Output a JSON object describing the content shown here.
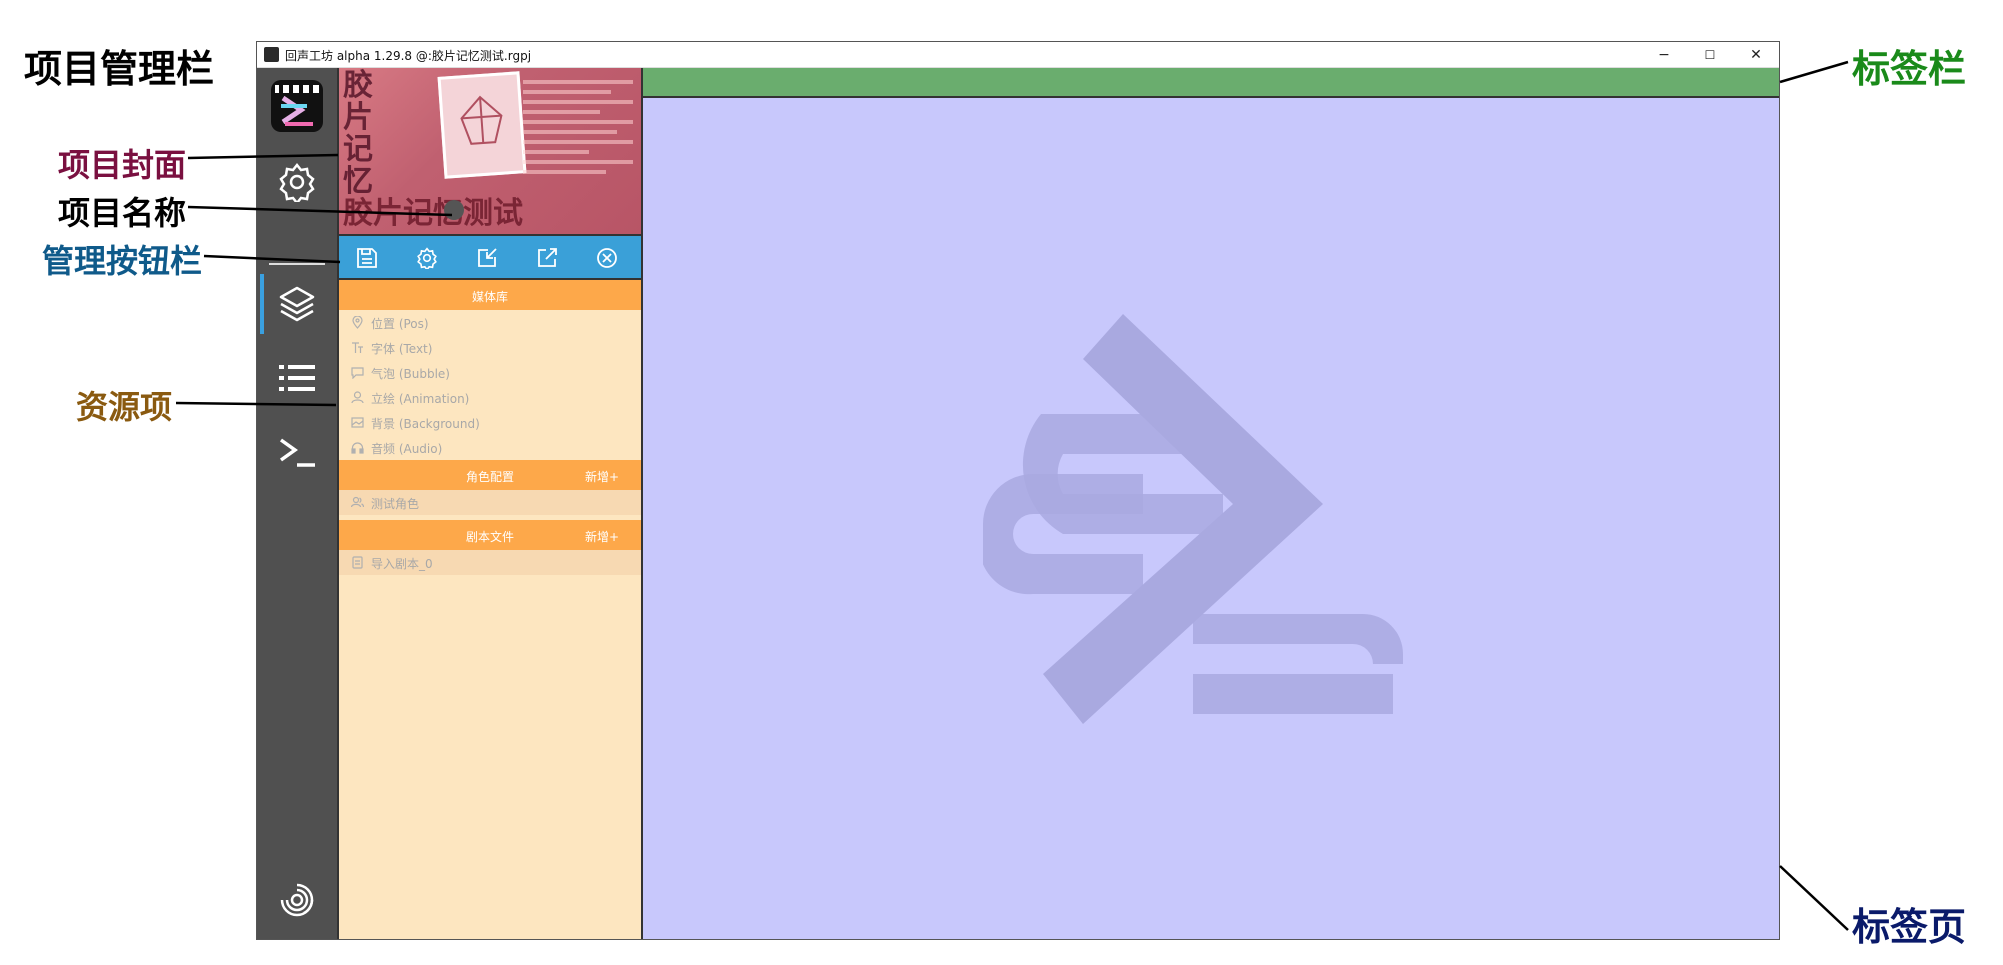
{
  "annotations": {
    "project_bar": "项目管理栏",
    "project_cover": "项目封面",
    "project_name": "项目名称",
    "manage_buttons": "管理按钮栏",
    "resource_item": "资源项",
    "tab_bar": "标签栏",
    "tab_page": "标签页",
    "colors": {
      "project_bar": "#000000",
      "project_cover": "#7a1040",
      "project_name": "#000000",
      "manage_buttons": "#0f5a8a",
      "resource_item": "#8a5a10",
      "tab_bar": "#1a8a1a",
      "tab_page": "#0a1a6a"
    }
  },
  "window": {
    "title": "回声工坊 alpha 1.29.8 @:胶片记忆测试.rgpj",
    "minimize": "−",
    "maximize": "☐",
    "close": "✕"
  },
  "sidebar": {
    "icons": [
      "app-logo-icon",
      "settings-gear-icon",
      "layers-icon",
      "list-icon",
      "terminal-icon",
      "spiral-icon"
    ]
  },
  "project": {
    "cover_text": "胶片记忆",
    "name": "胶片记忆测试"
  },
  "manage_buttons": [
    "save-icon",
    "project-settings-icon",
    "import-icon",
    "export-icon",
    "close-project-icon"
  ],
  "media_library": {
    "header": "媒体库",
    "items": [
      {
        "label": "位置 (Pos)",
        "icon": "pin-icon"
      },
      {
        "label": "字体 (Text)",
        "icon": "text-icon"
      },
      {
        "label": "气泡 (Bubble)",
        "icon": "bubble-icon"
      },
      {
        "label": "立绘 (Animation)",
        "icon": "person-icon"
      },
      {
        "label": "背景 (Background)",
        "icon": "image-icon"
      },
      {
        "label": "音频 (Audio)",
        "icon": "headphone-icon"
      }
    ]
  },
  "character_config": {
    "header": "角色配置",
    "add": "新增+",
    "items": [
      {
        "label": "测试角色",
        "icon": "users-icon"
      }
    ]
  },
  "script_files": {
    "header": "剧本文件",
    "add": "新增+",
    "items": [
      {
        "label": "导入剧本_0",
        "icon": "file-icon"
      }
    ]
  },
  "colors": {
    "sidebar": "#505050",
    "panel": "#fde6c0",
    "section_header": "#fda84a",
    "button_bar": "#3aa0d8",
    "tab_bar": "#6aad6e",
    "tab_page": "#c8c8fc",
    "watermark": "#a9a9e0"
  }
}
